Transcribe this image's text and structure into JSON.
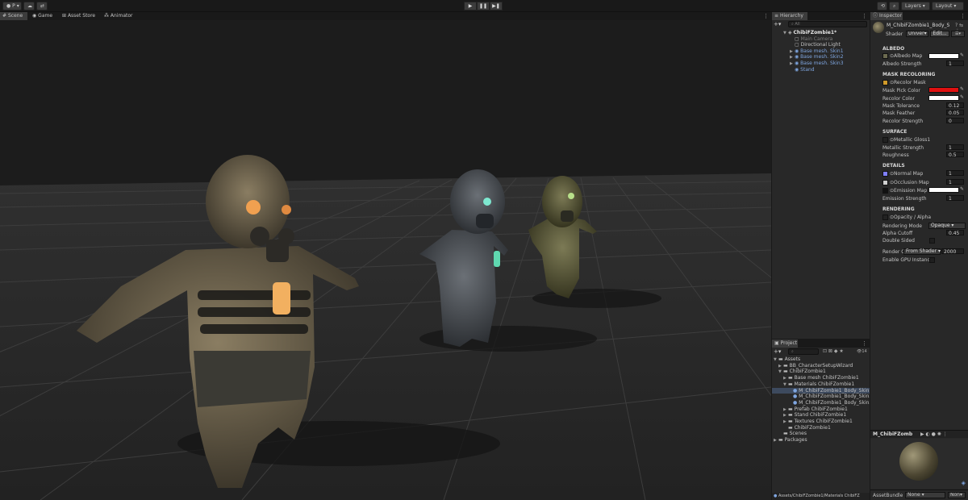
{
  "toolbar": {
    "account_label": "P",
    "cloud_icon": "cloud-icon",
    "collab_icon": "collab-icon",
    "play_icon": "▶",
    "pause_icon": "❚❚",
    "step_icon": "▶❚",
    "history_icon": "history-icon",
    "search_icon": "search-icon",
    "layers_label": "Layers",
    "layout_label": "Layout"
  },
  "scene_tabs": [
    "Scene",
    "Game",
    "Asset Store",
    "Animator"
  ],
  "hierarchy": {
    "tab": "Hierarchy",
    "search_placeholder": "All",
    "items": [
      {
        "label": "ChibiFZombie1*",
        "indent": 0,
        "style": "white",
        "arrow": "▼"
      },
      {
        "label": "Main Camera",
        "indent": 1,
        "style": "dim",
        "arrow": ""
      },
      {
        "label": "Directional Light",
        "indent": 1,
        "style": "normal",
        "arrow": ""
      },
      {
        "label": "Base mesh. Skin1",
        "indent": 1,
        "style": "blue",
        "arrow": "▶"
      },
      {
        "label": "Base mesh. Skin2",
        "indent": 1,
        "style": "blue",
        "arrow": "▶"
      },
      {
        "label": "Base mesh. Skin3",
        "indent": 1,
        "style": "blue",
        "arrow": "▶"
      },
      {
        "label": "Stand",
        "indent": 1,
        "style": "blue",
        "arrow": ""
      }
    ]
  },
  "project": {
    "tab": "Project",
    "count": "14",
    "items": [
      {
        "label": "Assets",
        "indent": 0,
        "arrow": "▼"
      },
      {
        "label": "BB_CharacterSetupWizard",
        "indent": 1,
        "arrow": "▶"
      },
      {
        "label": "ChibiFZombie1",
        "indent": 1,
        "arrow": "▼"
      },
      {
        "label": "Base mesh ChibiFZombie1",
        "indent": 2,
        "arrow": "▶"
      },
      {
        "label": "Materials ChibiFZombie1",
        "indent": 2,
        "arrow": "▼"
      },
      {
        "label": "M_ChibiFZombie1_Body_Skin1",
        "indent": 3,
        "arrow": "",
        "selected": true
      },
      {
        "label": "M_ChibiFZombie1_Body_Skin2",
        "indent": 3,
        "arrow": ""
      },
      {
        "label": "M_ChibiFZombie1_Body_Skin3",
        "indent": 3,
        "arrow": ""
      },
      {
        "label": "Prefab ChibiFZombie1",
        "indent": 2,
        "arrow": "▶"
      },
      {
        "label": "Stand ChibiFZombie1",
        "indent": 2,
        "arrow": "▶"
      },
      {
        "label": "Textures ChibiFZombie1",
        "indent": 2,
        "arrow": "▶"
      },
      {
        "label": "ChibiFZombie1",
        "indent": 2,
        "arrow": ""
      },
      {
        "label": "Scenes",
        "indent": 1,
        "arrow": ""
      },
      {
        "label": "Packages",
        "indent": 0,
        "arrow": "▶"
      }
    ],
    "path": "Assets/ChibiFZombie1/Materials ChibiFZ"
  },
  "inspector": {
    "tab": "Inspector",
    "material_name": "M_ChibiFZombie1_Body_S",
    "shader_label": "Shader",
    "shader_value": "Univer",
    "edit_label": "Edit...",
    "sections": {
      "albedo": "ALBEDO",
      "mask": "MASK RECOLORING",
      "surface": "SURFACE",
      "details": "DETAILS",
      "rendering": "RENDERING"
    },
    "albedo_map": "Albedo Map",
    "albedo_strength_label": "Albedo Strength",
    "albedo_strength": "1",
    "recolor_mask": "Recolor Mask",
    "mask_pick_color": "Mask Pick Color",
    "recolor_color": "Recolor Color",
    "mask_tolerance_label": "Mask Tolerance",
    "mask_tolerance": "0.12",
    "mask_feather_label": "Mask Feather",
    "mask_feather": "0.05",
    "recolor_strength_label": "Recolor Strength",
    "recolor_strength": "0",
    "metallic_gloss": "Metallic Gloss1",
    "metallic_strength_label": "Metallic Strength",
    "metallic_strength": "1",
    "roughness_label": "Roughness",
    "roughness": "0.5",
    "normal_map": "Normal Map",
    "normal_val": "1",
    "occlusion_map": "Occlusion Map",
    "occlusion_val": "1",
    "emission_map": "Emission Map",
    "emission_strength_label": "Emission Strength",
    "emission_strength": "1",
    "opacity_label": "Opacity / Alpha",
    "rendering_mode_label": "Rendering Mode",
    "rendering_mode": "Opaque",
    "alpha_cutoff_label": "Alpha Cutoff",
    "alpha_cutoff": "0.45",
    "double_sided_label": "Double Sided",
    "render_q_label": "Render Q",
    "render_q_mode": "From Shader",
    "render_q_value": "2000",
    "gpu_instancing_label": "Enable GPU Instanci",
    "preview_name": "M_ChibiFZomb",
    "assetbundle_label": "AssetBundle",
    "assetbundle_value": "None",
    "assetbundle_variant": "Non",
    "colors": {
      "albedo": "#ffffff",
      "mask_pick": "#e01010",
      "recolor": "#ffffff",
      "emission": "#ffffff"
    }
  }
}
